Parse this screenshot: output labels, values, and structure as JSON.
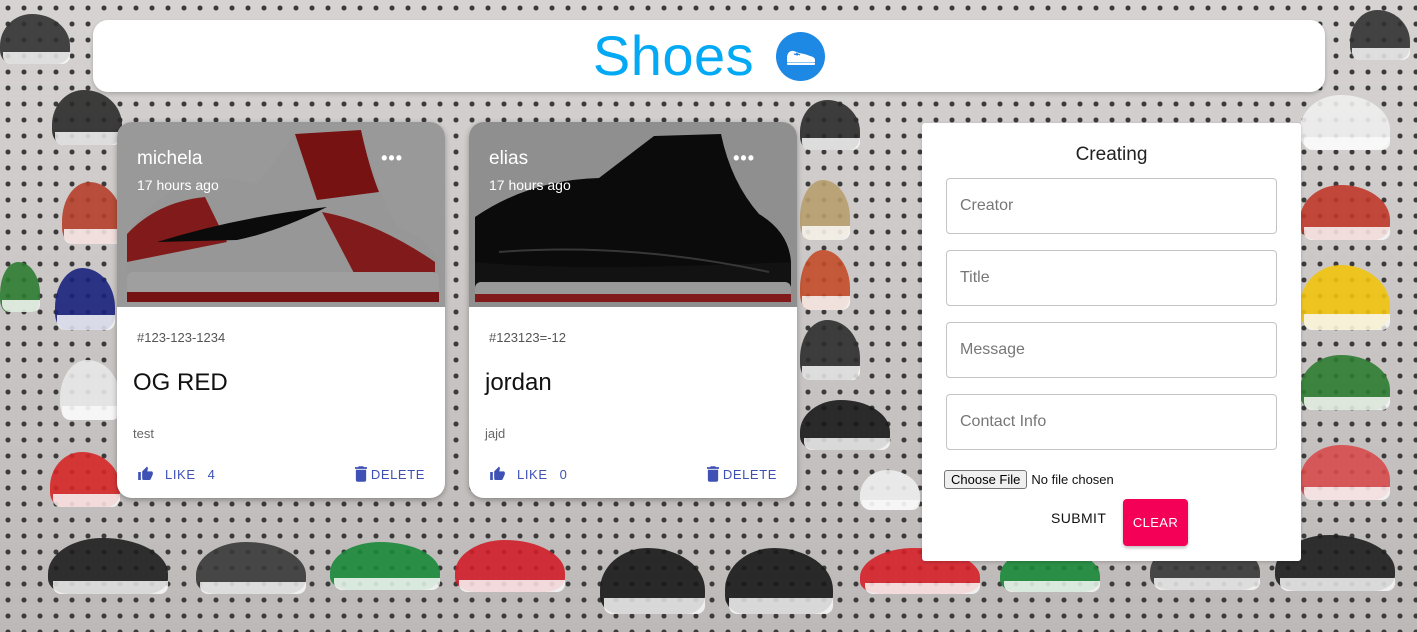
{
  "app": {
    "title": "Shoes",
    "logo_icon": "shoe-icon",
    "accent_color": "#03a9f4"
  },
  "posts": [
    {
      "creator": "michela",
      "time": "17 hours ago",
      "tags": "#123-123-1234",
      "title": "OG RED",
      "message": "test",
      "like_label": "LIKE",
      "like_count": "4",
      "delete_label": "DELETE",
      "image_description_icon": "red-white-high-top-sneaker"
    },
    {
      "creator": "elias",
      "time": "17 hours ago",
      "tags": "#123123=-12",
      "title": "jordan",
      "message": "jajd",
      "like_label": "LIKE",
      "like_count": "0",
      "delete_label": "DELETE",
      "image_description_icon": "black-patent-leather-sneaker"
    }
  ],
  "form": {
    "heading": "Creating",
    "creator_placeholder": "Creator",
    "title_placeholder": "Title",
    "message_placeholder": "Message",
    "contact_placeholder": "Contact Info",
    "file_button_label": "Choose File",
    "file_status": "No file chosen",
    "submit_label": "SUBMIT",
    "clear_label": "CLEAR",
    "clear_color": "#f50057"
  }
}
